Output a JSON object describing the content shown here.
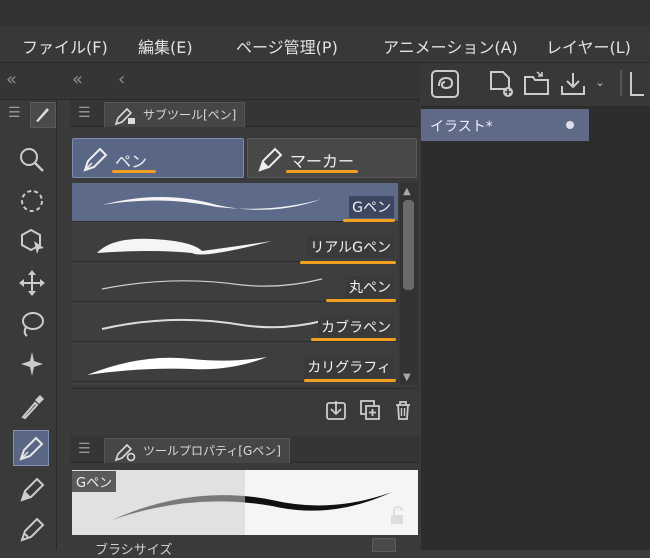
{
  "menu": {
    "items": [
      {
        "label": "ファイル(F)"
      },
      {
        "label": "編集(E)"
      },
      {
        "label": "ページ管理(P)"
      },
      {
        "label": "アニメーション(A)"
      },
      {
        "label": "レイヤー(L)"
      }
    ]
  },
  "row2": {
    "collapse_left": "«",
    "collapse_mid": "«",
    "back": "‹"
  },
  "panels": {
    "subtool": {
      "tab_label": "サブツール[ペン]",
      "groups": [
        {
          "label": "ペン",
          "selected": true
        },
        {
          "label": "マーカー",
          "selected": false
        }
      ],
      "brushes": [
        {
          "name": "Gペン",
          "selected": true
        },
        {
          "name": "リアルGペン",
          "selected": false
        },
        {
          "name": "丸ペン",
          "selected": false
        },
        {
          "name": "カブラペン",
          "selected": false
        },
        {
          "name": "カリグラフィ",
          "selected": false
        }
      ]
    },
    "toolprop": {
      "tab_label": "ツールプロパティ[Gペン]",
      "preview_label": "Gペン",
      "next_row_label": "ブラシサイズ"
    }
  },
  "canvas": {
    "tab_label": "イラスト*"
  },
  "colors": {
    "accent_underline": "#f0a01e",
    "selection": "#5d6a8a"
  },
  "icons": {
    "left_tools": [
      "zoom-icon",
      "rotate-icon",
      "object-select-icon",
      "move-icon",
      "lasso-icon",
      "auto-select-icon",
      "eyedropper-icon",
      "pen-icon",
      "pencil-icon",
      "brush-icon"
    ]
  }
}
